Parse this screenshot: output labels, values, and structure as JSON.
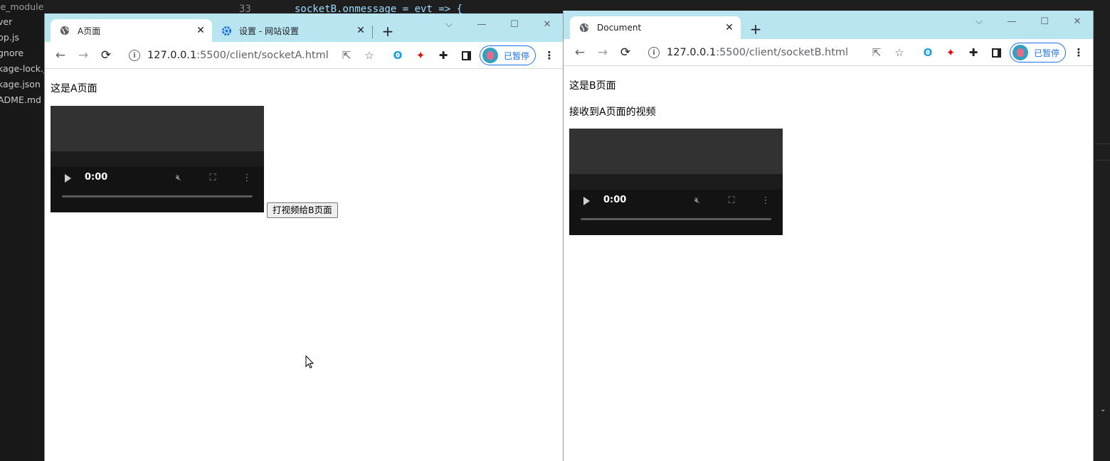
{
  "editor": {
    "files": [
      "le_modules",
      "ver",
      "pp.js",
      "gnore",
      "kage-lock.j",
      "kage.json",
      "ADME.md"
    ],
    "line_number": "33",
    "code_object": "socketB",
    "code_rest": "onmessage = evt => {"
  },
  "window_a": {
    "tabs": [
      {
        "title": "A页面",
        "icon": "globe-icon",
        "active": true
      },
      {
        "title": "设置 - 网站设置",
        "icon": "gear-icon",
        "active": false
      }
    ],
    "url_host": "127.0.0.1",
    "url_path": ":5500/client/socketA.html",
    "profile_label": "已暂停",
    "page": {
      "heading": "这是A页面",
      "video_time": "0:00",
      "button_label": "打视频给B页面"
    }
  },
  "window_b": {
    "tabs": [
      {
        "title": "Document",
        "icon": "globe-icon",
        "active": true
      }
    ],
    "url_host": "127.0.0.1",
    "url_path": ":5500/client/socketB.html",
    "profile_label": "已暂停",
    "page": {
      "heading": "这是B页面",
      "subheading": "接收到A页面的视频",
      "video_time": "0:00"
    }
  },
  "colors": {
    "tabstrip": "#b9e5f0",
    "profile_accent": "#1a73e8",
    "editor_bg": "#1e1e1e"
  }
}
